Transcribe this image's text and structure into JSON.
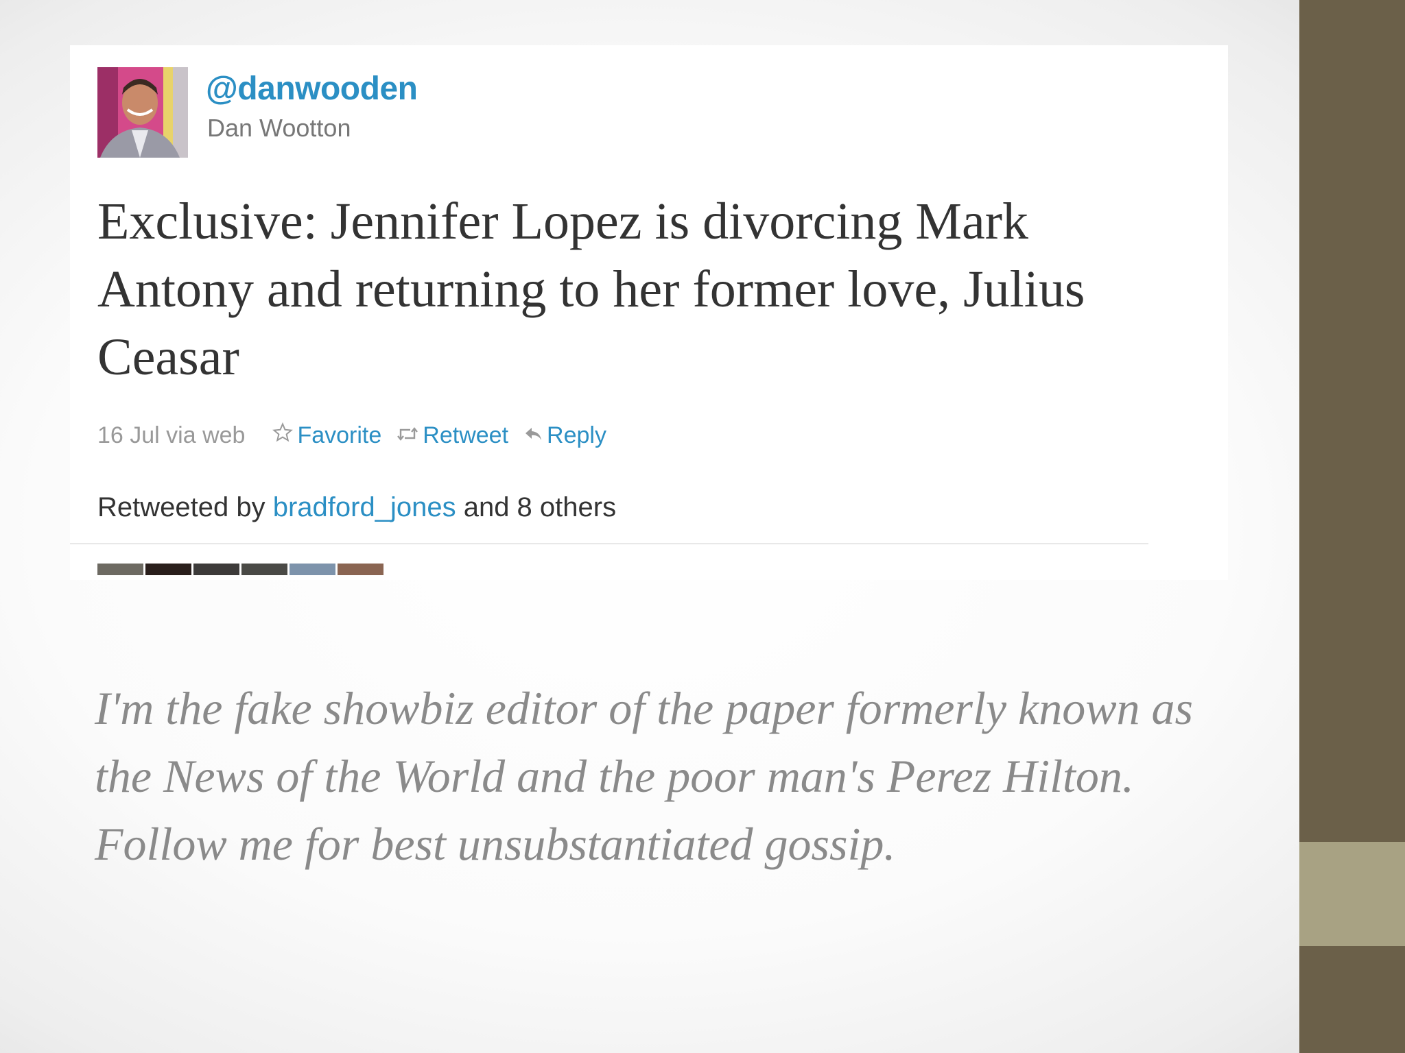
{
  "tweet": {
    "handle": "@danwooden",
    "display_name": "Dan Wootton",
    "text": "Exclusive: Jennifer Lopez is divorcing Mark Antony and returning to her former love, Julius Ceasar",
    "timestamp": "16 Jul via web",
    "actions": {
      "favorite": "Favorite",
      "retweet": "Retweet",
      "reply": "Reply"
    },
    "retweeted_by": {
      "prefix": "Retweeted by",
      "user": "bradford_jones",
      "suffix": "and 8 others"
    },
    "retweeter_thumbnails": [
      "#6d6a62",
      "#2a1f1c",
      "#3d3b3a",
      "#4a4a46",
      "#7d93ab",
      "#8a6552"
    ]
  },
  "bio": {
    "text": "I'm the fake showbiz editor of the paper formerly known as the News of the World and the poor man's Perez Hilton. Follow me for best unsubstantiated gossip."
  },
  "colors": {
    "link": "#2b8fc4",
    "side_strip": "#6b6049",
    "side_accent": "#a8a283"
  }
}
